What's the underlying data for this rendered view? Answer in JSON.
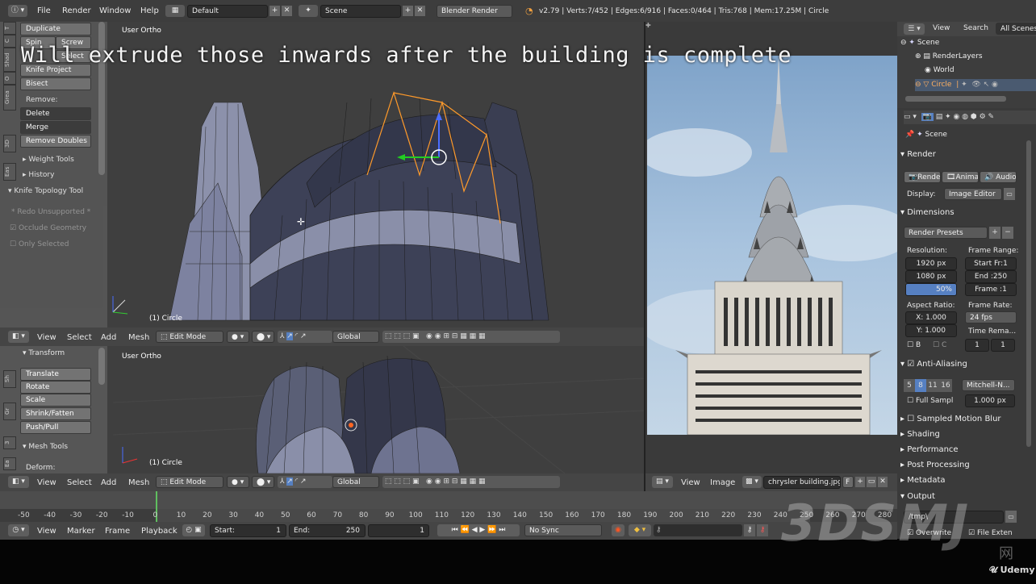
{
  "topbar": {
    "menus": [
      "File",
      "Render",
      "Window",
      "Help"
    ],
    "layout": "Default",
    "scene": "Scene",
    "engine": "Blender Render",
    "stats": "v2.79 | Verts:7/452 | Edges:6/916 | Faces:0/464 | Tris:768 | Mem:17.25M | Circle"
  },
  "overlay_caption": "Will extrude those inwards after the building is complete",
  "toolshelf_top": {
    "tabs": [
      "T",
      "C",
      "Shad",
      "O",
      "Grea",
      "3D",
      "Eas"
    ],
    "buttons": [
      "Duplicate",
      "Spin",
      "Screw",
      "Select",
      "Knife Project",
      "Bisect"
    ],
    "remove_label": "Remove:",
    "delete": "Delete",
    "merge": "Merge",
    "remove_doubles": "Remove Doubles",
    "weight_tools": "Weight Tools",
    "history": "History",
    "knife_panel": "Knife Topology Tool",
    "redo": "* Redo Unsupported *",
    "occlude": "Occlude Geometry",
    "only_selected": "Only Selected"
  },
  "viewport_top": {
    "title": "User Ortho",
    "object": "(1) Circle"
  },
  "viewport_bottom": {
    "title": "User Ortho",
    "object": "(1) Circle"
  },
  "toolshelf_bottom": {
    "tabs": [
      "Sh",
      "Gr",
      "3",
      "Ea"
    ],
    "transform": "Transform",
    "buttons": [
      "Translate",
      "Rotate",
      "Scale",
      "Shrink/Fatten",
      "Push/Pull"
    ],
    "mesh_tools": "Mesh Tools",
    "deform": "Deform:"
  },
  "view3d_header": {
    "menus": [
      "View",
      "Select",
      "Add",
      "Mesh"
    ],
    "mode": "Edit Mode",
    "orientation": "Global"
  },
  "image_editor": {
    "menus": [
      "View",
      "Image"
    ],
    "file": "chrysler building.jpg",
    "flag": "F"
  },
  "outliner": {
    "menus": [
      "View",
      "Search"
    ],
    "filter": "All Scenes",
    "items": [
      "Scene",
      "RenderLayers",
      "World",
      "Circle"
    ]
  },
  "properties": {
    "context": "Scene",
    "render_panel": "Render",
    "render_btn": "Render",
    "anim_btn": "Animati",
    "audio_btn": "Audio",
    "display_label": "Display:",
    "display_value": "Image Editor",
    "dimensions": "Dimensions",
    "presets": "Render Presets",
    "resolution_label": "Resolution:",
    "res_x": "1920 px",
    "res_y": "1080 px",
    "res_pct": "50%",
    "frame_range_label": "Frame Range:",
    "start": "Start Fr:1",
    "end": "End :250",
    "frame": "Frame :1",
    "aspect_label": "Aspect Ratio:",
    "asp_x": "X:  1.000",
    "asp_y": "Y:  1.000",
    "b": "B",
    "c": "C",
    "frame_rate_label": "Frame Rate:",
    "fps": "24 fps",
    "time_remap": "Time Rema...",
    "remap_a": "1",
    "remap_b": "1",
    "anti_aliasing": "Anti-Aliasing",
    "aa_samples": [
      "5",
      "8",
      "11",
      "16"
    ],
    "aa_filter": "Mitchell-N...",
    "full_sample": "Full Sampl",
    "filter_size": "1.000 px",
    "sampled_motion_blur": "Sampled Motion Blur",
    "shading": "Shading",
    "performance": "Performance",
    "post_processing": "Post Processing",
    "metadata": "Metadata",
    "output": "Output",
    "output_path": "/tmp\\",
    "overwrite": "Overwrite",
    "file_ext": "File Exten"
  },
  "timeline_ruler": [
    "-50",
    "-40",
    "-30",
    "-20",
    "-10",
    "0",
    "10",
    "20",
    "30",
    "40",
    "50",
    "60",
    "70",
    "80",
    "90",
    "100",
    "110",
    "120",
    "130",
    "140",
    "150",
    "160",
    "170",
    "180",
    "190",
    "200",
    "210",
    "220",
    "230",
    "240",
    "250",
    "260",
    "270",
    "280"
  ],
  "timeline_header": {
    "menus": [
      "View",
      "Marker",
      "Frame",
      "Playback"
    ],
    "start_label": "Start:",
    "start": "1",
    "end_label": "End:",
    "end": "250",
    "current": "1",
    "sync": "No Sync"
  },
  "watermark": "3DSMJ",
  "watermark_sub": "网",
  "udemy": "Udemy",
  "colors": {
    "selected_edges": "#ff9a2a",
    "active_blue": "#5680c2",
    "sky": "#9bbbdb"
  }
}
